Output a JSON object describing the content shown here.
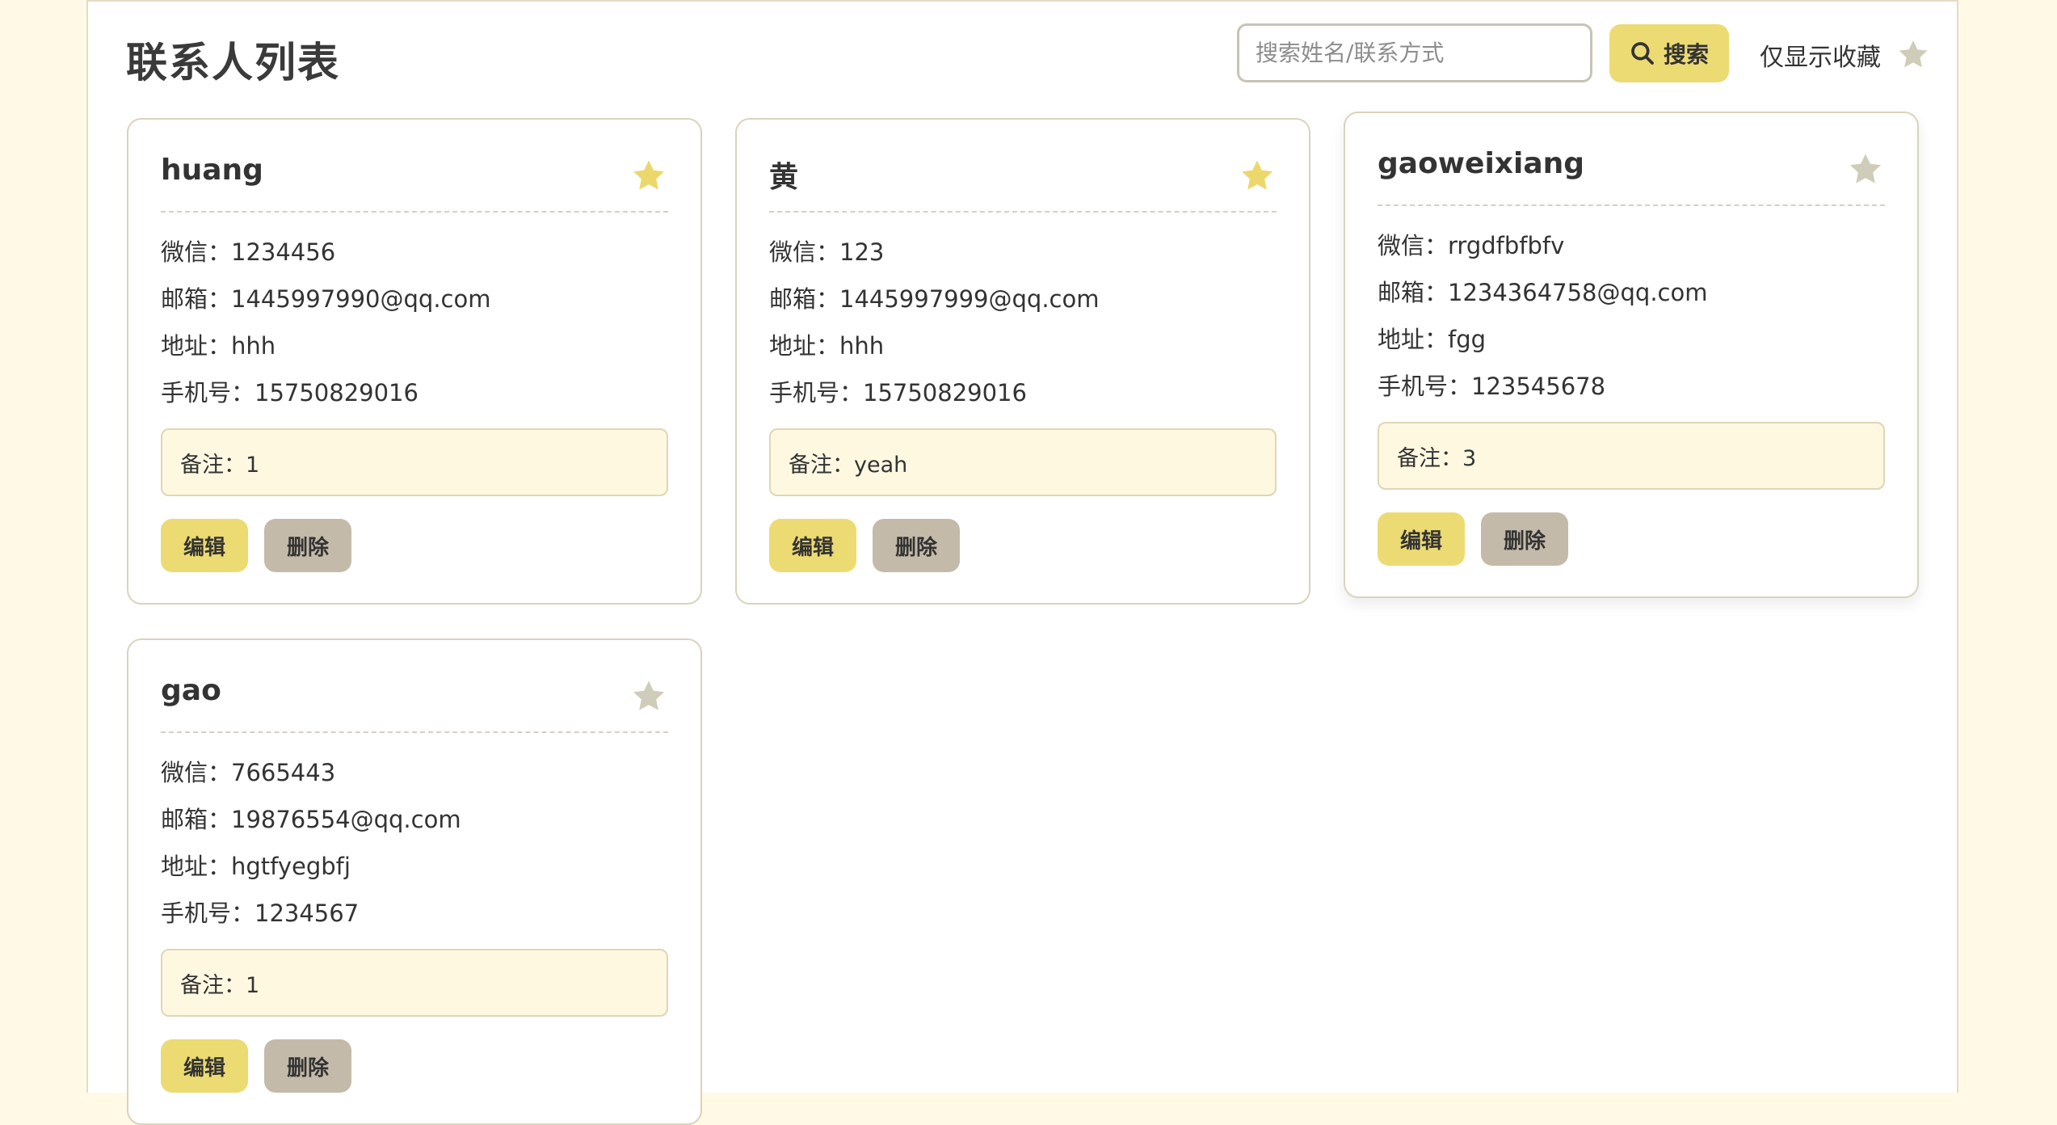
{
  "header": {
    "title": "联系人列表",
    "search_placeholder": "搜索姓名/联系方式",
    "search_button_label": "搜索",
    "favorites_filter_label": "仅显示收藏"
  },
  "colors": {
    "star_active": "#ecd86a",
    "star_inactive": "#cfcdb9",
    "accent": "#ecdb73",
    "delete": "#c4baa9"
  },
  "contacts": [
    {
      "name": "huang",
      "favorite": true,
      "wechat": "微信：1234456",
      "email": "邮箱：1445997990@qq.com",
      "address": "地址：hhh",
      "phone": "手机号：15750829016",
      "note": "备注：1",
      "edit_label": "编辑",
      "delete_label": "删除"
    },
    {
      "name": "黄",
      "favorite": true,
      "wechat": "微信：123",
      "email": "邮箱：1445997999@qq.com",
      "address": "地址：hhh",
      "phone": "手机号：15750829016",
      "note": "备注：yeah",
      "edit_label": "编辑",
      "delete_label": "删除"
    },
    {
      "name": "gaoweixiang",
      "favorite": false,
      "wechat": "微信：rrgdfbfbfv",
      "email": "邮箱：1234364758@qq.com",
      "address": "地址：fgg",
      "phone": "手机号：123545678",
      "note": "备注：3",
      "edit_label": "编辑",
      "delete_label": "删除"
    },
    {
      "name": "gao",
      "favorite": false,
      "wechat": "微信：7665443",
      "email": "邮箱：19876554@qq.com",
      "address": "地址：hgtfyegbfj",
      "phone": "手机号：1234567",
      "note": "备注：1",
      "edit_label": "编辑",
      "delete_label": "删除"
    }
  ]
}
